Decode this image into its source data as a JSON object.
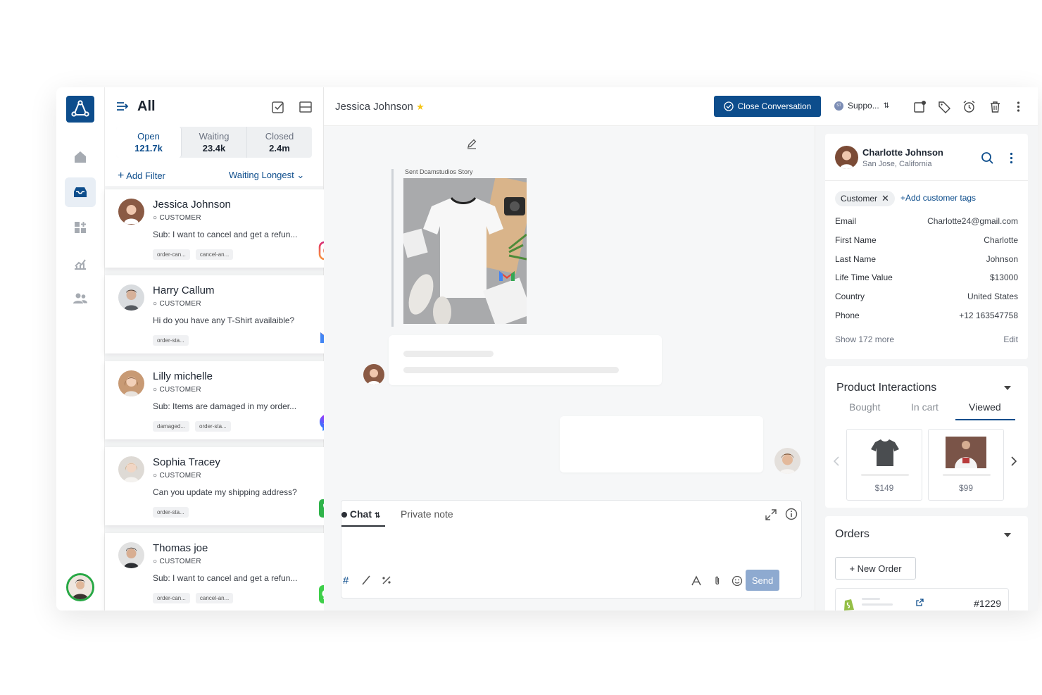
{
  "list": {
    "title": "All",
    "tabs": [
      {
        "label": "Open",
        "count": "121.7k"
      },
      {
        "label": "Waiting",
        "count": "23.4k"
      },
      {
        "label": "Closed",
        "count": "2.4m"
      }
    ],
    "add_filter": "Add Filter",
    "sort": "Waiting Longest",
    "conversations": [
      {
        "name": "Jessica Johnson",
        "role": "CUSTOMER",
        "subject": "Sub: I want to cancel and get a refun...",
        "tags": [
          "order-can...",
          "cancel-an..."
        ],
        "channel": "instagram-icon"
      },
      {
        "name": "Harry Callum",
        "role": "CUSTOMER",
        "subject": "Hi do you have any T-Shirt availaible?",
        "tags": [
          "order-sta..."
        ],
        "channel": "gmail-icon"
      },
      {
        "name": "Lilly michelle",
        "role": "CUSTOMER",
        "subject": "Sub: Items are damaged in my order...",
        "tags": [
          "damaged...",
          "order-sta..."
        ],
        "channel": "messenger-icon"
      },
      {
        "name": "Sophia Tracey",
        "role": "CUSTOMER",
        "subject": "Can you update my shipping address?",
        "tags": [
          "order-sta..."
        ],
        "channel": "phone-icon"
      },
      {
        "name": "Thomas joe",
        "role": "CUSTOMER",
        "subject": "Sub: I want to cancel and get a refun...",
        "tags": [
          "order-can...",
          "cancel-an..."
        ],
        "channel": "imessage-icon"
      }
    ]
  },
  "chat": {
    "contact_name": "Jessica Johnson",
    "close_button": "Close Conversation",
    "team": "Suppo...",
    "team_badge": "ST",
    "story_label": "Sent Dcamstudios Story",
    "composer": {
      "tab_chat": "Chat",
      "tab_note": "Private note",
      "send": "Send"
    }
  },
  "profile": {
    "name": "Charlotte Johnson",
    "location": "San Jose, California",
    "tag": "Customer",
    "add_tags": "+Add customer tags",
    "fields": [
      {
        "label": "Email",
        "value": "Charlotte24@gmail.com"
      },
      {
        "label": "First Name",
        "value": "Charlotte"
      },
      {
        "label": "Last Name",
        "value": "Johnson"
      },
      {
        "label": "Life Time Value",
        "value": "$13000"
      },
      {
        "label": "Country",
        "value": "United States"
      },
      {
        "label": "Phone",
        "value": "+12 163547758"
      }
    ],
    "show_more": "Show 172 more",
    "edit": "Edit"
  },
  "products": {
    "title": "Product Interactions",
    "tabs": [
      "Bought",
      "In cart",
      "Viewed"
    ],
    "active_tab": "Viewed",
    "items": [
      {
        "price": "$149"
      },
      {
        "price": "$99"
      }
    ]
  },
  "orders": {
    "title": "Orders",
    "new_order": "+ New Order",
    "order_number": "#1229"
  },
  "colors": {
    "brand": "#0d4d8c",
    "accent_star": "#f5c518",
    "send_disabled": "#8eaad0"
  }
}
